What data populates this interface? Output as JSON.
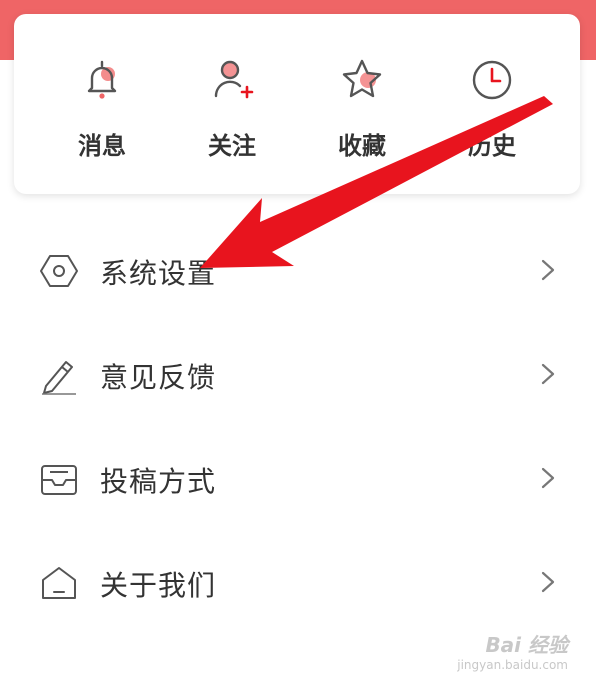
{
  "quick_actions": [
    {
      "label": "消息",
      "icon": "bell-icon"
    },
    {
      "label": "关注",
      "icon": "user-add-icon"
    },
    {
      "label": "收藏",
      "icon": "star-icon"
    },
    {
      "label": "历史",
      "icon": "clock-icon"
    }
  ],
  "menu": [
    {
      "label": "系统设置",
      "icon": "hexagon-settings-icon"
    },
    {
      "label": "意见反馈",
      "icon": "pencil-icon"
    },
    {
      "label": "投稿方式",
      "icon": "mail-tray-icon"
    },
    {
      "label": "关于我们",
      "icon": "home-icon"
    }
  ],
  "watermark": {
    "brand": "Bai 经验",
    "url": "jingyan.baidu.com"
  },
  "colors": {
    "accent": "#ef6566",
    "arrow": "#e8141e",
    "text": "#333333",
    "icon": "#555555"
  }
}
